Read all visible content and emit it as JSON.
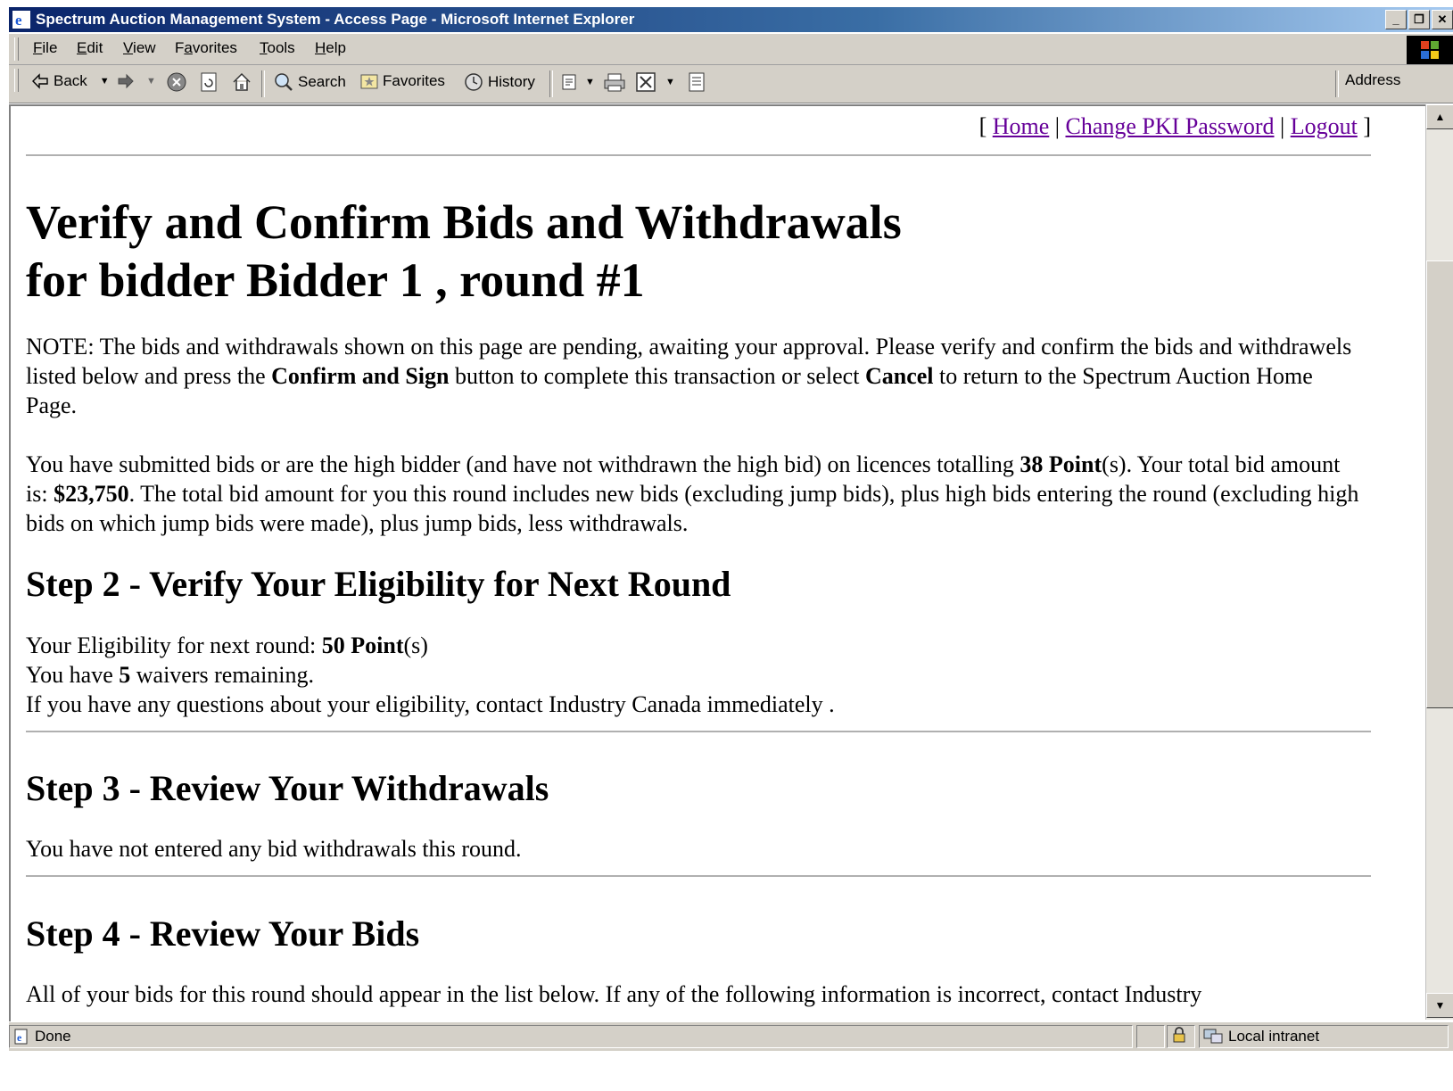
{
  "window": {
    "title": "Spectrum Auction Management System - Access Page - Microsoft Internet Explorer"
  },
  "menubar": {
    "items": [
      {
        "pre": "",
        "ul": "F",
        "post": "ile"
      },
      {
        "pre": "",
        "ul": "E",
        "post": "dit"
      },
      {
        "pre": "",
        "ul": "V",
        "post": "iew"
      },
      {
        "pre": "F",
        "ul": "a",
        "post": "vorites"
      },
      {
        "pre": "",
        "ul": "T",
        "post": "ools"
      },
      {
        "pre": "",
        "ul": "H",
        "post": "elp"
      }
    ]
  },
  "toolbar": {
    "back_label": "Back",
    "search_label": "Search",
    "favorites_label": "Favorites",
    "history_label": "History",
    "address_label": "Address"
  },
  "page": {
    "links": {
      "open_bracket": "[",
      "home": "Home",
      "sep": "|",
      "change_pki": "Change PKI Password",
      "logout": "Logout",
      "close_bracket": "]"
    },
    "heading_line1": "Verify and Confirm Bids and Withdrawals",
    "heading_line2": "for bidder Bidder 1 , round #1",
    "note": {
      "t1": "NOTE: The bids and withdrawals shown on this page are pending, awaiting your approval. Please verify and confirm the bids and withdrawels listed below and press the ",
      "b1": "Confirm and Sign",
      "t2": " button to complete this transaction or select ",
      "b2": "Cancel",
      "t3": " to return to the Spectrum Auction Home Page."
    },
    "summary": {
      "t1": "You have submitted bids or are the high bidder (and have not withdrawn the high bid) on licences totalling ",
      "points": "38 Point",
      "t2": "(s). Your total bid amount is: ",
      "amount": "$23,750",
      "t3": ". The total bid amount for you this round includes new bids (excluding jump bids), plus high bids entering the round (excluding high bids on which jump bids were made), plus jump bids, less withdrawals."
    },
    "step2": {
      "heading": "Step 2 - Verify Your Eligibility for Next Round",
      "elig_prefix": "Your Eligibility for next round: ",
      "elig_value": "50 Point",
      "elig_suffix": "(s)",
      "waivers_prefix": "You have ",
      "waivers_value": "5",
      "waivers_suffix": " waivers remaining.",
      "questions": "If you have any questions about your eligibility, contact Industry Canada immediately ."
    },
    "step3": {
      "heading": "Step 3 - Review Your Withdrawals",
      "text": "You have not entered any bid withdrawals this round."
    },
    "step4": {
      "heading": "Step 4 - Review Your Bids",
      "text": "All of your bids for this round should appear in the list below. If any of the following information is incorrect, contact Industry"
    }
  },
  "statusbar": {
    "status": "Done",
    "zone": "Local intranet"
  },
  "colors": {
    "titlebar_start": "#0a246a",
    "link": "#660099",
    "chrome": "#d4d0c8"
  }
}
